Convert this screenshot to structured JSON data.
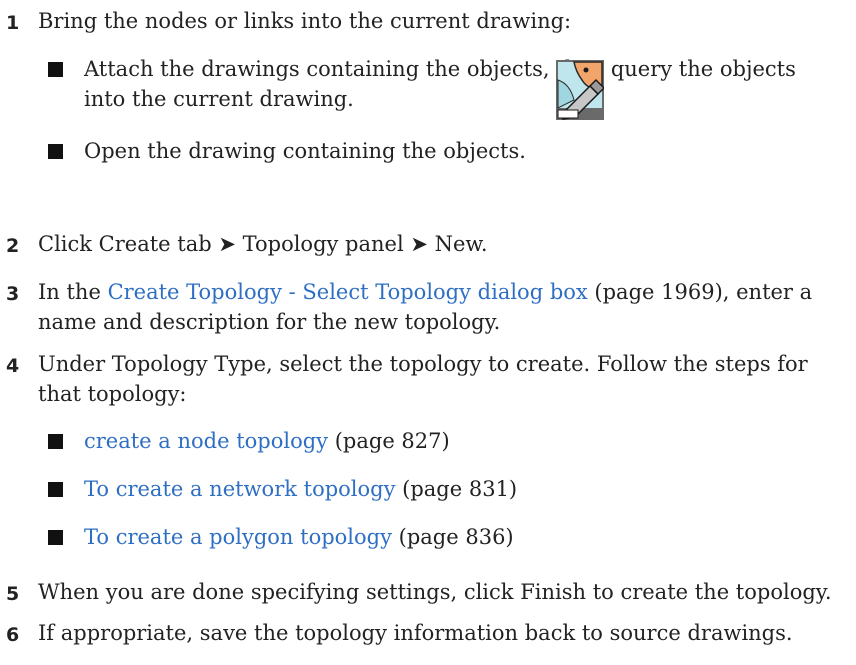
{
  "steps": [
    {
      "num": "1",
      "text": "Bring the nodes or links into the current drawing:"
    },
    {
      "num": "2",
      "text": "Click Create tab ➤ Topology panel ➤ New."
    },
    {
      "num": "3",
      "text_pre": "In the ",
      "link": "Create Topology - Select Topology dialog box",
      "line1_post": " (page 1969), enter a",
      "line2": "name and description for the new topology."
    },
    {
      "num": "4",
      "line1": "Under Topology Type, select the topology to create. Follow the steps for",
      "line2": "that topology:"
    },
    {
      "num": "5",
      "text": "When you are done specifying settings, click Finish to create the topology."
    },
    {
      "num": "6",
      "text": "If appropriate, save the topology information back to source drawings."
    }
  ],
  "step1_bullets": [
    {
      "line1": "Attach the drawings containing the objects, then query the objects",
      "line2": "into the current drawing."
    },
    {
      "line1": "Open the drawing containing the objects."
    }
  ],
  "step4_bullets": [
    {
      "link": "create a node topology",
      "page": " (page 827)"
    },
    {
      "link": "To create a network topology",
      "page": " (page 831)"
    },
    {
      "link": "To create a polygon topology",
      "page": " (page 836)"
    }
  ],
  "colors": {
    "link": "#2e6fc4",
    "text": "#222222"
  },
  "icon": "topology-new-icon"
}
